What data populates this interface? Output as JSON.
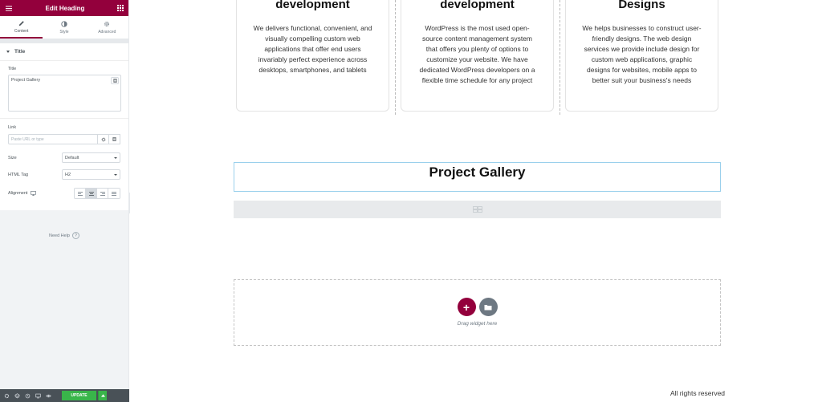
{
  "editor": {
    "title": "Edit Heading",
    "tabs": [
      {
        "label": "Content"
      },
      {
        "label": "Style"
      },
      {
        "label": "Advanced"
      }
    ],
    "section_title": "Title",
    "fields": {
      "title_label": "Title",
      "title_value": "Project Gallery",
      "link_label": "Link",
      "link_placeholder": "Paste URL or type",
      "size_label": "Size",
      "size_value": "Default",
      "html_tag_label": "HTML Tag",
      "html_tag_value": "H2",
      "alignment_label": "Alignment"
    },
    "need_help": "Need Help",
    "update_label": "UPDATE",
    "accent_color": "#93003c",
    "update_color": "#39b54a"
  },
  "canvas": {
    "cards": [
      {
        "heading": "development",
        "text": "We delivers functional, convenient, and visually compelling custom web applications that offer end users invariably perfect experience across desktops, smartphones, and tablets"
      },
      {
        "heading": "development",
        "text": "WordPress is the most used open-source content management system that offers you plenty of options to customize your website. We have dedicated WordPress developers on a flexible time schedule for any project"
      },
      {
        "heading": "Designs",
        "text": "We helps businesses to construct user-friendly designs. The web design services we provide include design for custom web applications, graphic designs for websites, mobile apps to better suit your business's needs"
      }
    ],
    "heading": "Project Gallery",
    "drop_zone_text": "Drag widget here",
    "copyright": "All rights reserved"
  }
}
